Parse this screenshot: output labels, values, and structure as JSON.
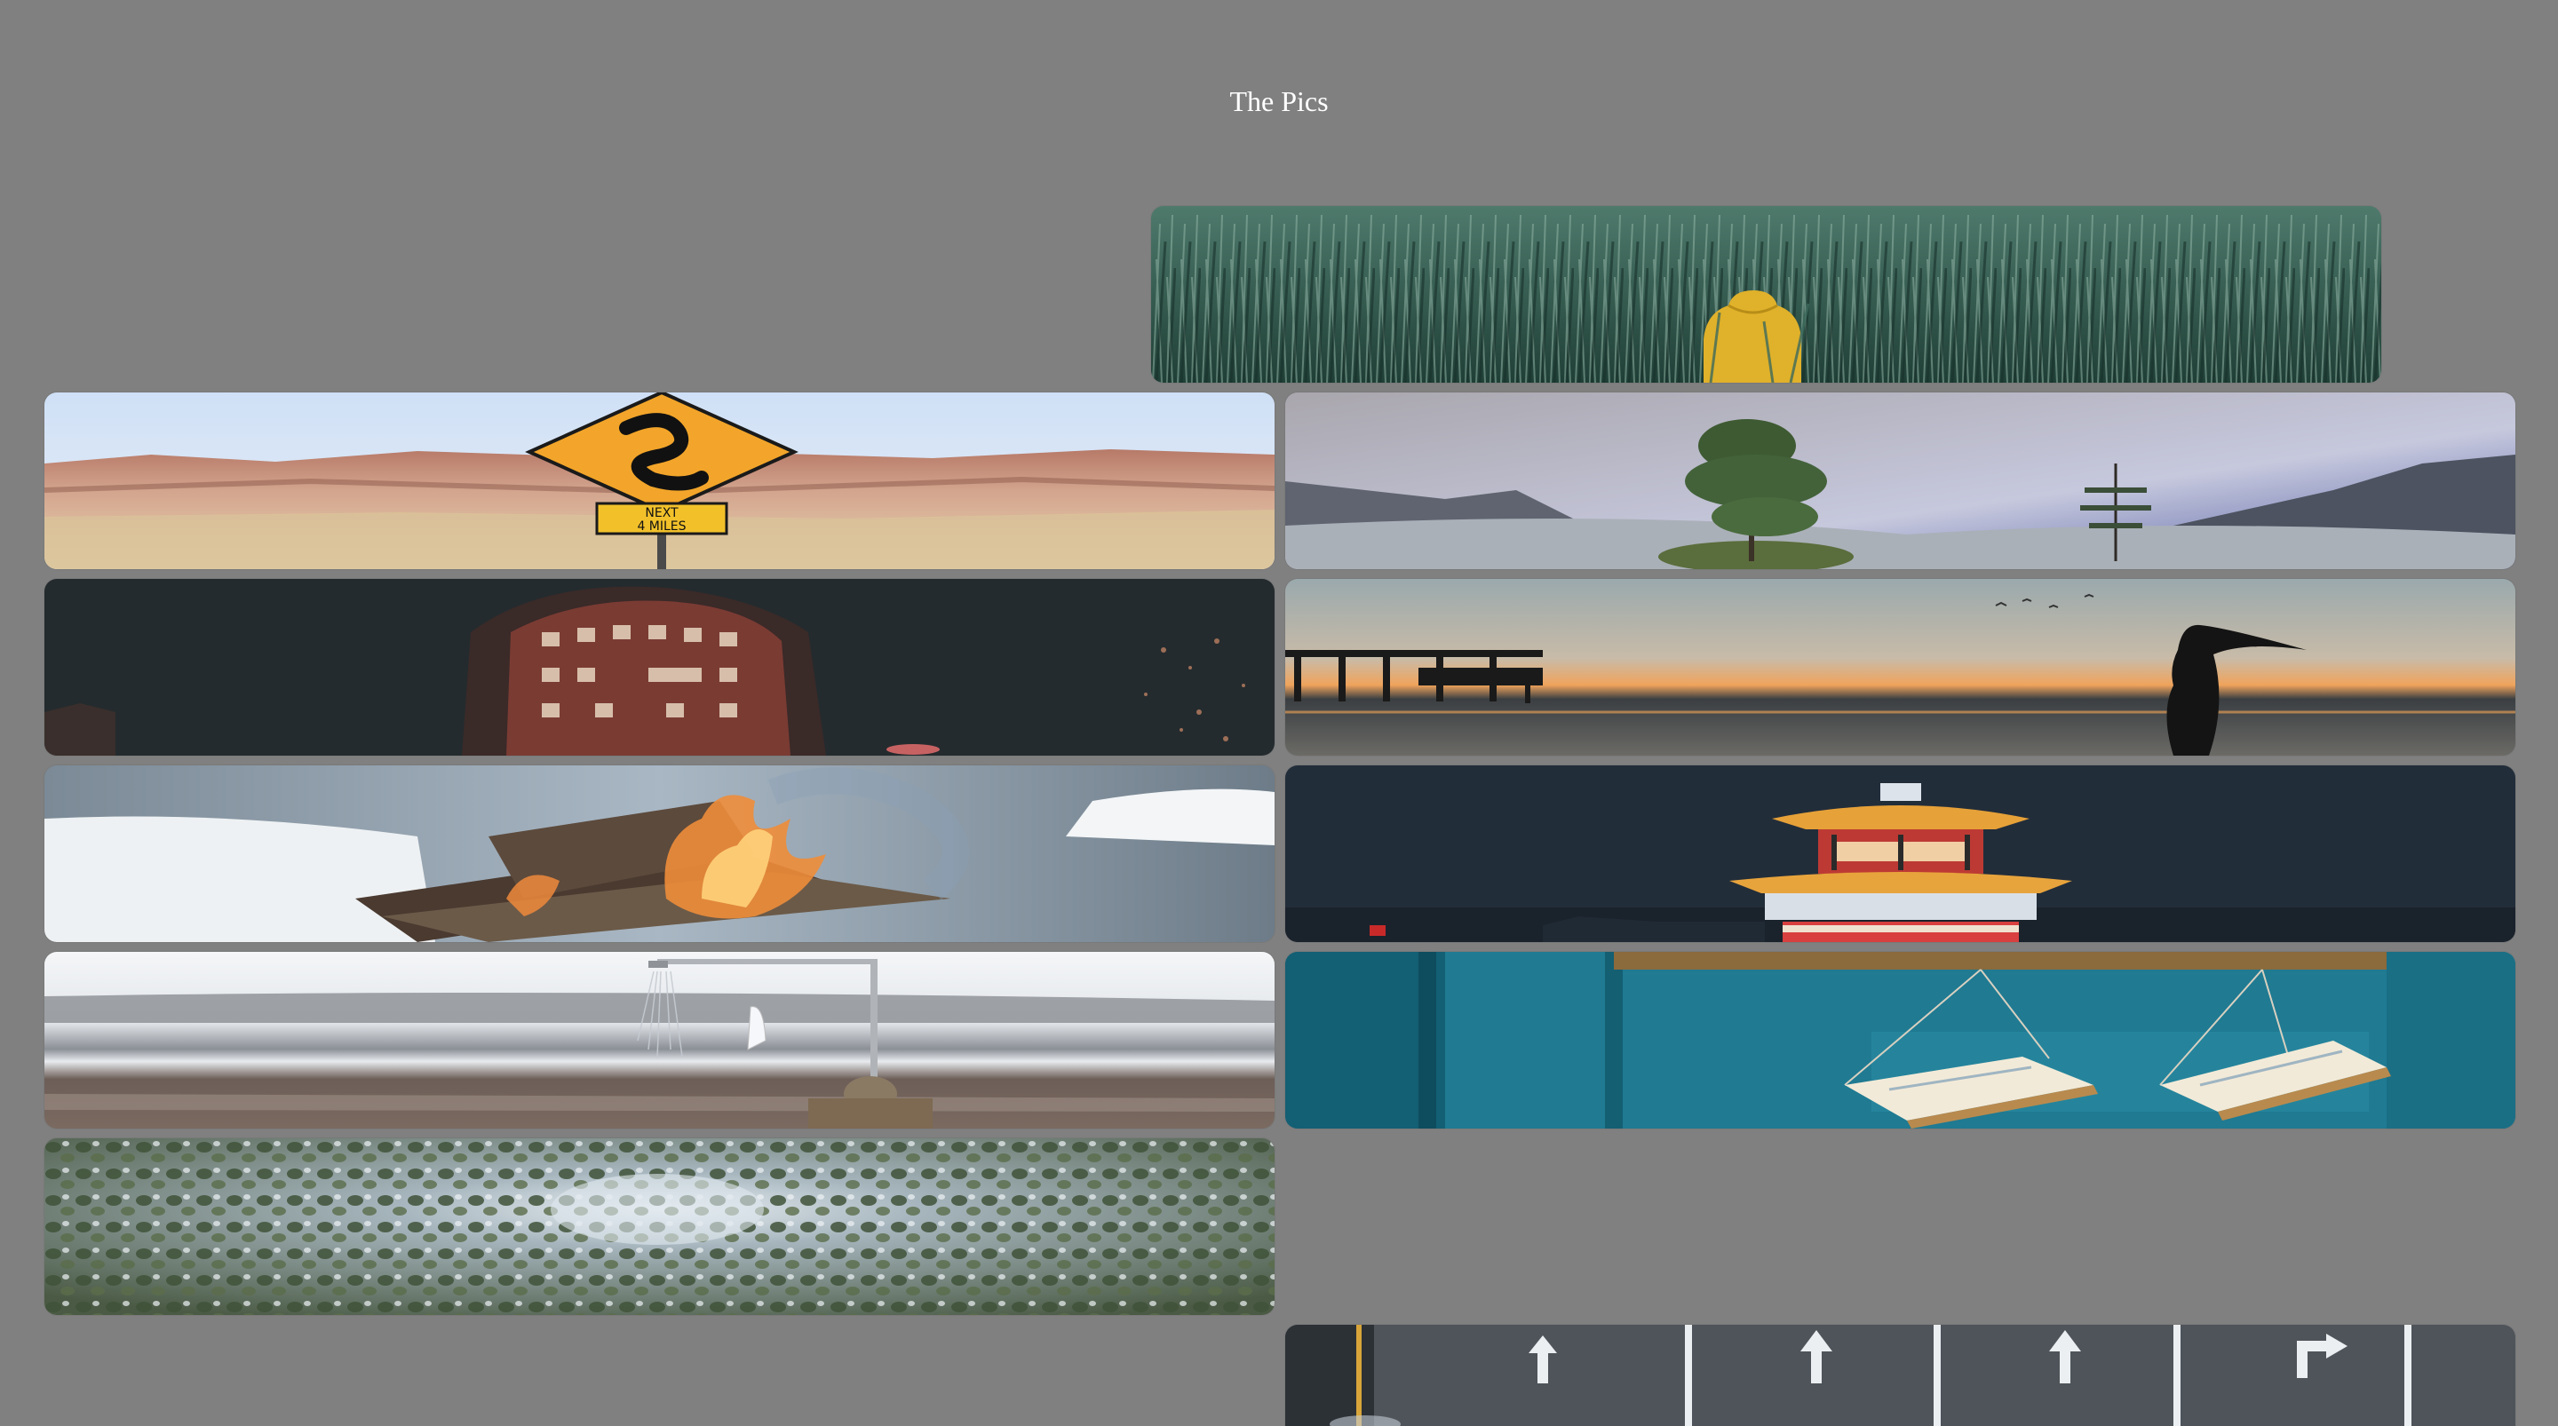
{
  "page": {
    "title": "The Pics"
  },
  "sign": {
    "line1": "NEXT",
    "line2": "4 MILES"
  },
  "colors": {
    "background": "#808080",
    "title_text": "#ffffff"
  }
}
